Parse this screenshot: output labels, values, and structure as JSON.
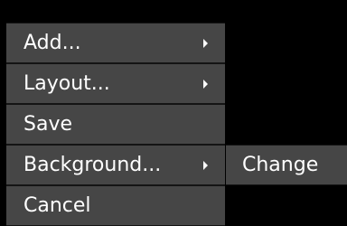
{
  "context_menu": {
    "items": [
      {
        "label": "Add...",
        "has_submenu": true,
        "icon": "chevron-right-icon"
      },
      {
        "label": "Layout...",
        "has_submenu": true,
        "icon": "chevron-right-icon"
      },
      {
        "label": "Save",
        "has_submenu": false
      },
      {
        "label": "Background...",
        "has_submenu": true,
        "icon": "chevron-right-icon"
      },
      {
        "label": "Cancel",
        "has_submenu": false
      }
    ]
  },
  "submenu": {
    "items": [
      {
        "label": "Change"
      }
    ]
  },
  "colors": {
    "background": "#000000",
    "menu_item": "#464646",
    "separator": "#141414",
    "text": "#ffffff"
  }
}
